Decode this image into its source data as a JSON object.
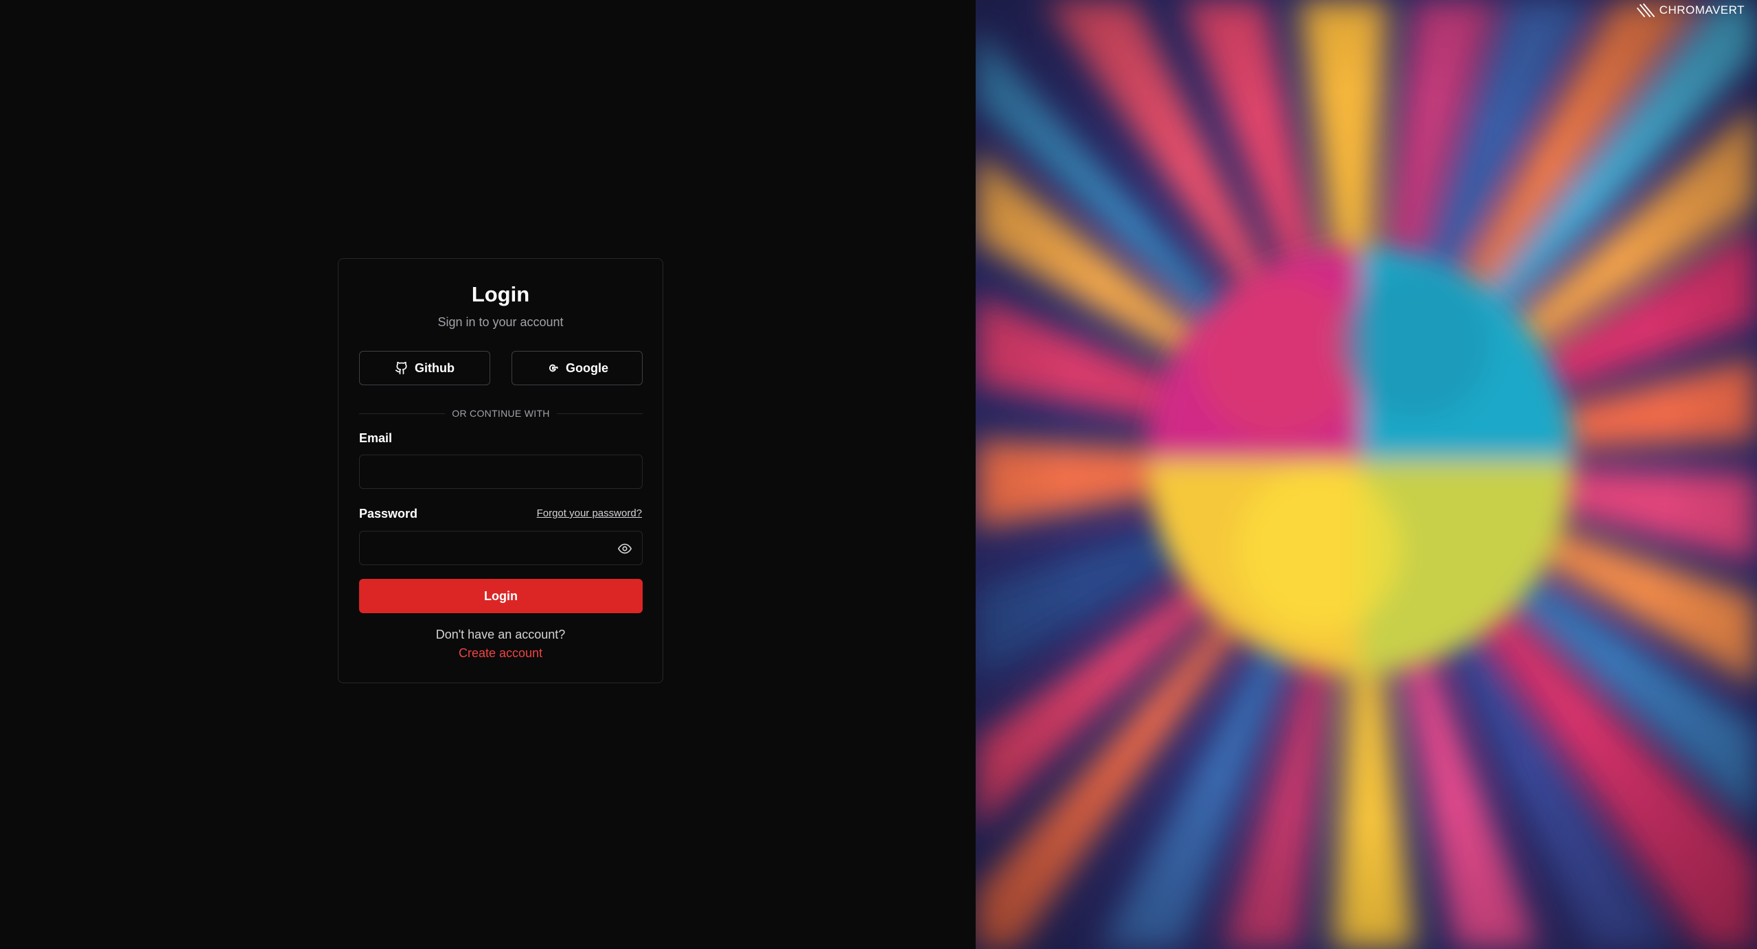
{
  "brand": {
    "name": "CHROMAVERT",
    "logo_icon": "chromavert-logo-icon"
  },
  "login": {
    "title": "Login",
    "subtitle": "Sign in to your account",
    "oauth": {
      "github_label": "Github",
      "github_icon": "github-icon",
      "google_label": "Google",
      "google_icon": "google-icon"
    },
    "divider_text": "OR CONTINUE WITH",
    "email": {
      "label": "Email",
      "value": "",
      "placeholder": ""
    },
    "password": {
      "label": "Password",
      "value": "",
      "placeholder": "",
      "toggle_icon": "eye-icon"
    },
    "forgot_password_label": "Forgot your password?",
    "submit_label": "Login",
    "no_account_text": "Don't have an account?",
    "create_account_label": "Create account"
  },
  "colors": {
    "background": "#0a0a0a",
    "accent": "#dc2626",
    "link_accent": "#ef4444",
    "border": "#27272a",
    "muted_text": "#a1a1aa"
  }
}
